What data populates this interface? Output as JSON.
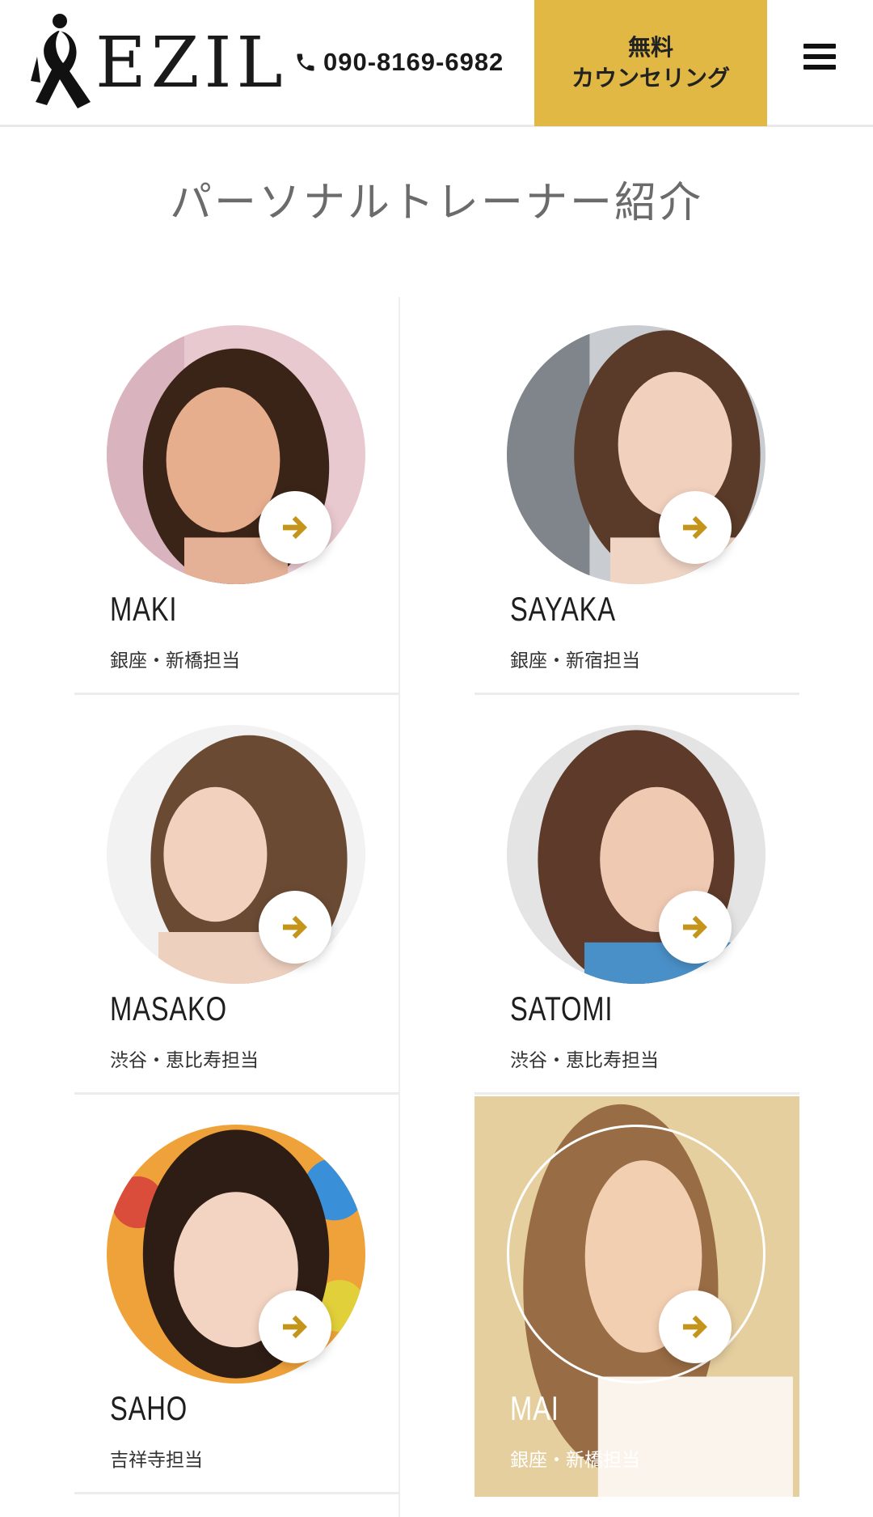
{
  "header": {
    "logo_text": "EZIL",
    "phone": "090-8169-6982",
    "cta_line1": "無料",
    "cta_line2": "カウンセリング"
  },
  "page_title": "パーソナルトレーナー紹介",
  "trainers": [
    {
      "name": "MAKI",
      "area": "銀座・新橋担当"
    },
    {
      "name": "SAYAKA",
      "area": "銀座・新宿担当"
    },
    {
      "name": "MASAKO",
      "area": "渋谷・恵比寿担当"
    },
    {
      "name": "SATOMI",
      "area": "渋谷・恵比寿担当"
    },
    {
      "name": "SAHO",
      "area": "吉祥寺担当"
    },
    {
      "name": "MAI",
      "area": "銀座・新橋担当"
    }
  ],
  "colors": {
    "accent": "#e2b845",
    "arrow": "#c4951a",
    "active_card": "#e8d2a4"
  },
  "icons": {
    "phone": "phone-icon",
    "menu": "hamburger-menu-icon",
    "arrow": "arrow-right-icon",
    "logo": "ribbon-figure-logo"
  }
}
